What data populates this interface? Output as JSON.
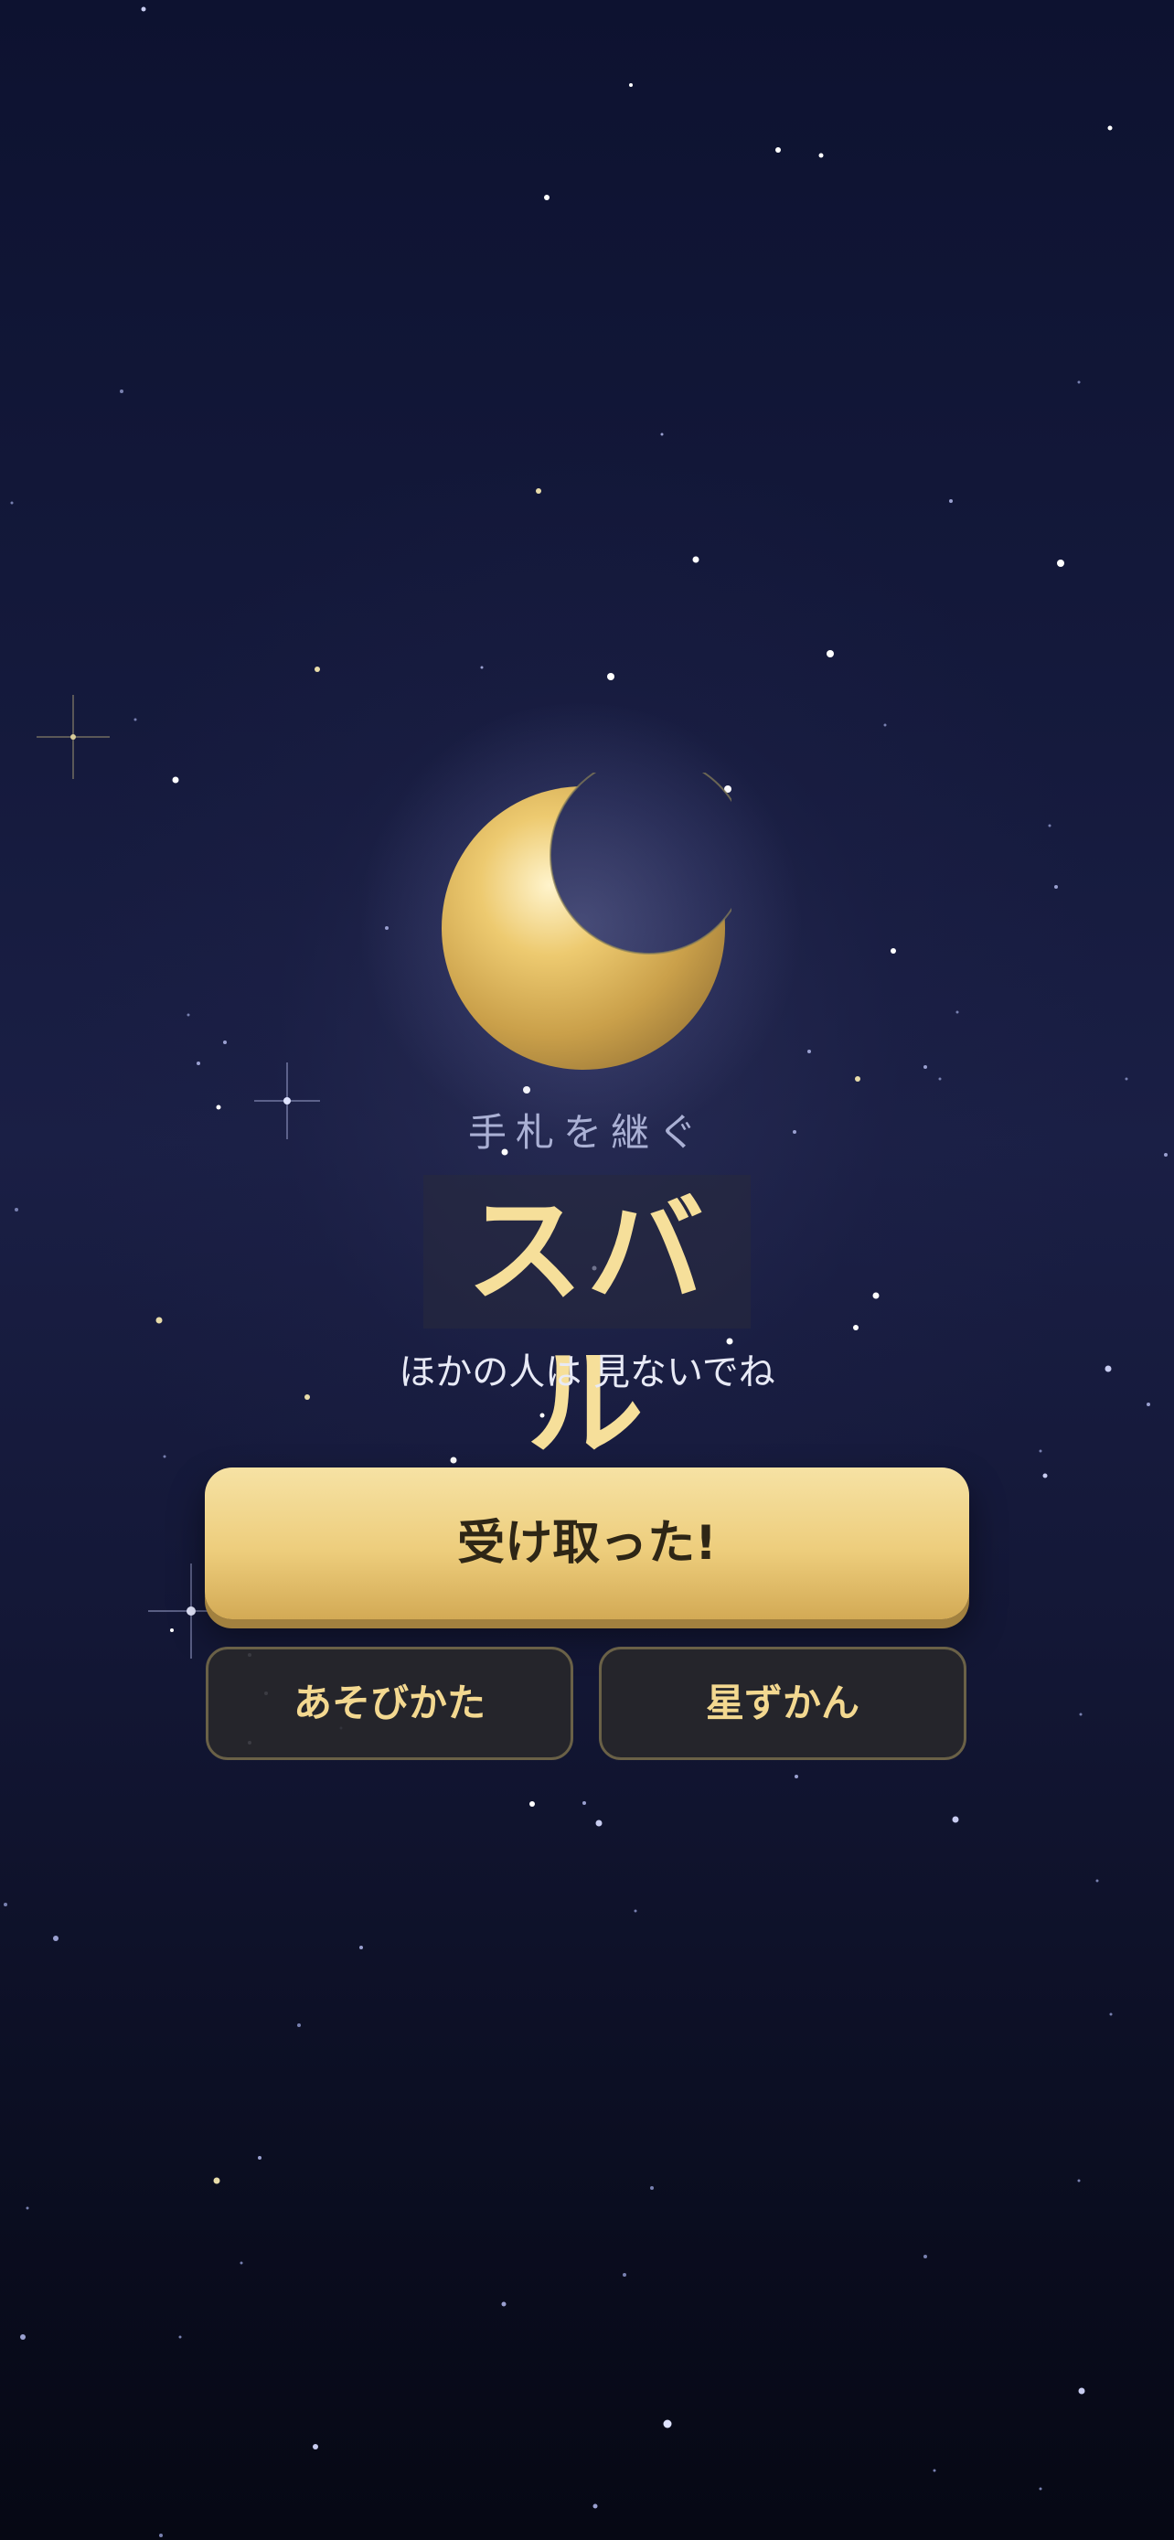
{
  "header": {
    "subtitle": "手札を継ぐ"
  },
  "card": {
    "name": "スバル",
    "caption": "ほかの人は 見ないでね",
    "icon": "crescent-moon-icon"
  },
  "actions": {
    "receive_label": "受け取った!",
    "howto_label": "あそびかた",
    "zukan_label": "星ずかん"
  },
  "colors": {
    "background_top": "#0d1230",
    "background_bottom": "#060814",
    "accent_gold": "#edcd7c",
    "name_gold": "#f6df9a",
    "subtitle": "#aab0d4"
  }
}
